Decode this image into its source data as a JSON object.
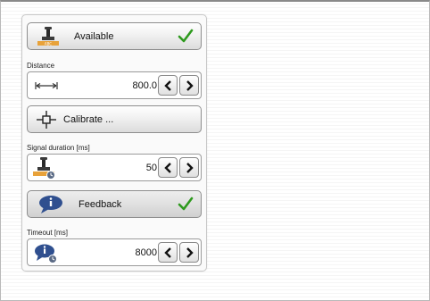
{
  "panel": {
    "available": {
      "label": "Available",
      "checked": true,
      "icon": "stamp-icon"
    },
    "distance": {
      "caption": "Distance",
      "value": "800.0",
      "icon": "distance-arrows-icon"
    },
    "calibrate": {
      "label": "Calibrate ...",
      "icon": "crosshair-icon"
    },
    "signal_duration": {
      "caption": "Signal duration [ms]",
      "value": "50",
      "icon": "stamp-timer-icon"
    },
    "feedback": {
      "label": "Feedback",
      "checked": true,
      "icon": "speech-bubble-info-icon"
    },
    "timeout": {
      "caption": "Timeout  [ms]",
      "value": "8000",
      "icon": "speech-bubble-timer-icon"
    }
  },
  "colors": {
    "check": "#2e9a1e",
    "bubble": "#2f4f8f",
    "stamp_base": "#e8a23a"
  }
}
